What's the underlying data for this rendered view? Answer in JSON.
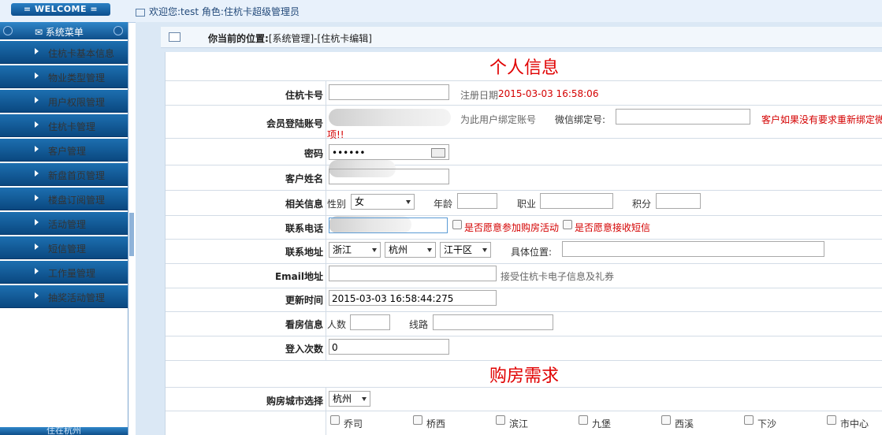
{
  "header": {
    "welcome": "= WELCOME =",
    "user_info": "欢迎您:test 角色:住杭卡超级管理员"
  },
  "sidebar": {
    "title": "系统菜单",
    "items": [
      {
        "label": "住杭卡基本信息"
      },
      {
        "label": "物业类型管理"
      },
      {
        "label": "用户权限管理"
      },
      {
        "label": "住杭卡管理"
      },
      {
        "label": "客户管理"
      },
      {
        "label": "新盘首页管理"
      },
      {
        "label": "楼盘订阅管理"
      },
      {
        "label": "活动管理"
      },
      {
        "label": "短信管理"
      },
      {
        "label": "工作量管理"
      },
      {
        "label": "抽奖活动管理"
      }
    ],
    "footer": "住在杭州"
  },
  "breadcrumb": {
    "prefix": "你当前的位置:",
    "path": "[系统管理]-[住杭卡编辑]"
  },
  "form": {
    "section1_title": "个人信息",
    "section2_title": "购房需求",
    "card_no": {
      "label": "住杭卡号",
      "value": "",
      "reg_date_label": "注册日期",
      "reg_date": "2015-03-03 16:58:06"
    },
    "member_account": {
      "label": "会员登陆账号",
      "hint": "为此用户绑定账号",
      "wechat_label": "微信绑定号:",
      "wechat_value": "",
      "warning": "客户如果没有要求重新绑定微",
      "warning2": "项!!"
    },
    "password": {
      "label": "密码",
      "value": "••••••"
    },
    "customer_name": {
      "label": "客户姓名"
    },
    "related": {
      "label": "相关信息",
      "gender_label": "性别",
      "gender": "女",
      "age_label": "年龄",
      "job_label": "职业",
      "points_label": "积分"
    },
    "phone": {
      "label": "联系电话",
      "opt1": "是否愿意参加购房活动",
      "opt2": "是否愿意接收短信"
    },
    "address": {
      "label": "联系地址",
      "province": "浙江",
      "city": "杭州",
      "district": "江干区",
      "detail_label": "具体位置:"
    },
    "email": {
      "label": "Email地址",
      "hint": "接受住杭卡电子信息及礼券"
    },
    "update_time": {
      "label": "更新时间",
      "value": "2015-03-03 16:58:44:275"
    },
    "viewing": {
      "label": "看房信息",
      "people_label": "人数",
      "route_label": "线路"
    },
    "login_count": {
      "label": "登入次数",
      "value": "0"
    },
    "buy_city": {
      "label": "购房城市选择",
      "value": "杭州"
    },
    "districts": [
      "乔司",
      "桥西",
      "滨江",
      "九堡",
      "西溪",
      "下沙",
      "市中心"
    ]
  }
}
